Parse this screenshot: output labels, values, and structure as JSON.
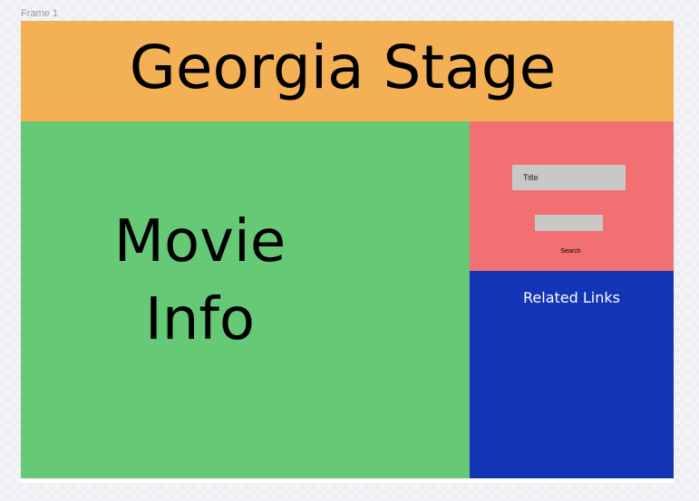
{
  "canvas": {
    "frame_label": "Frame 1"
  },
  "header": {
    "title": "Georgia Stage"
  },
  "main": {
    "title_line1": "Movie",
    "title_line2": "Info"
  },
  "search": {
    "title_placeholder": "Title",
    "second_value": "",
    "button_label": "Search"
  },
  "related": {
    "title": "Related Links"
  },
  "colors": {
    "header": "#f4b055",
    "main": "#66c975",
    "search_panel": "#f26f72",
    "links_panel": "#1335b6",
    "input": "#c8c8c8"
  }
}
